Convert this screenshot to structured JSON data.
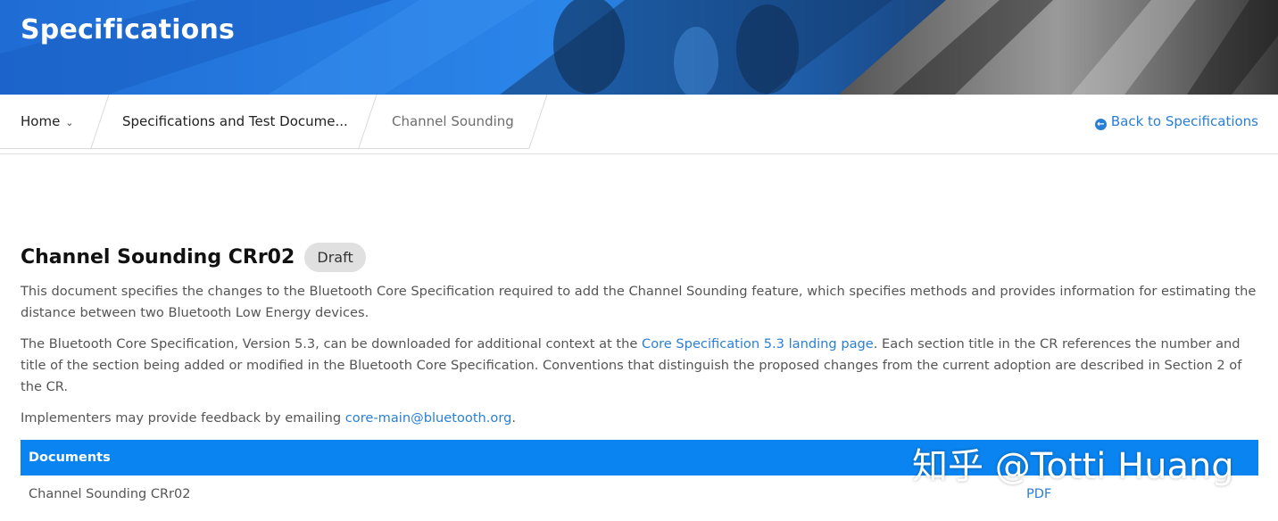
{
  "hero": {
    "title": "Specifications"
  },
  "breadcrumb": {
    "home": "Home",
    "section": "Specifications and Test Docume...",
    "current": "Channel Sounding"
  },
  "back_link": {
    "label": "Back to Specifications",
    "icon": "arrow-circle-left-icon"
  },
  "document": {
    "title": "Channel Sounding CRr02",
    "status_badge": "Draft",
    "paragraph1": "This document specifies the changes to the Bluetooth Core Specification required to add the Channel Sounding feature, which specifies methods and provides information for estimating the distance between two Bluetooth Low Energy devices.",
    "paragraph2_before": "The Bluetooth Core Specification, Version 5.3, can be downloaded for additional context at the ",
    "paragraph2_link": "Core Specification 5.3 landing page",
    "paragraph2_after": ". Each section title in the CR references the number and title of the section being added or modified in the Bluetooth Core Specification. Conventions that distinguish the proposed changes from the current adoption are described in Section 2 of the CR.",
    "paragraph3_before": "Implementers may provide feedback by emailing ",
    "paragraph3_link": "core-main@bluetooth.org",
    "paragraph3_after": "."
  },
  "documents_table": {
    "header": "Documents",
    "rows": [
      {
        "name": "Channel Sounding CRr02",
        "format": "PDF"
      }
    ]
  },
  "watermark": "知乎 @Totti Huang",
  "colors": {
    "link": "#2a7fd4",
    "table_header": "#0a84f0",
    "hero_blue": "#1f6fd8"
  }
}
